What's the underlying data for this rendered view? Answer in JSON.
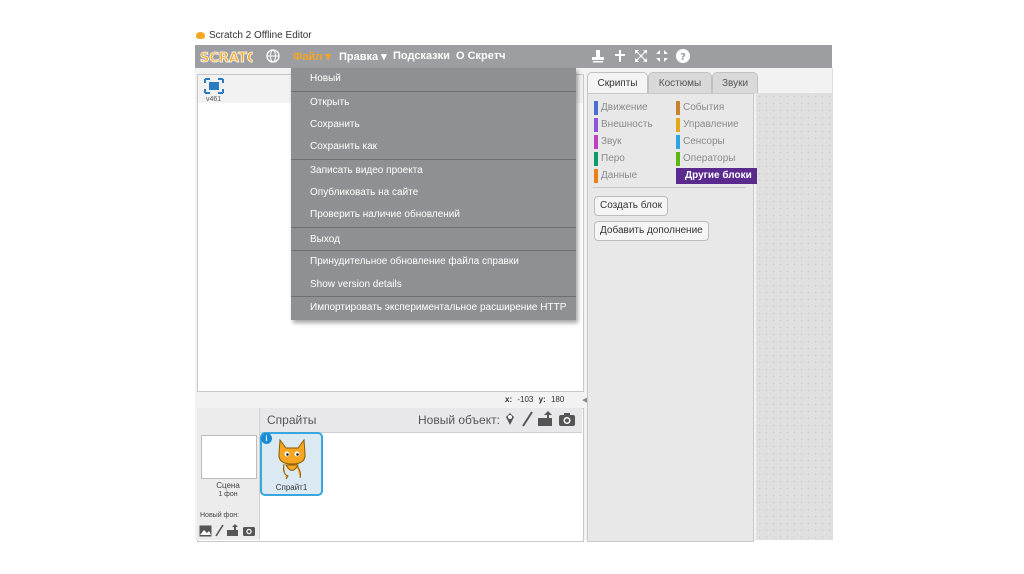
{
  "window": {
    "title": "Scratch 2 Offline Editor"
  },
  "logo": {
    "text": "SCRATCH"
  },
  "menubar": {
    "file": "Файл ▾",
    "edit": "Правка ▾",
    "tips": "Подсказки",
    "about": "О Скретч",
    "icons": [
      "globe-icon",
      "duplicate-stamp-icon",
      "delete-cut-icon",
      "grow-icon",
      "shrink-icon",
      "help-icon"
    ]
  },
  "file_menu": {
    "items": [
      "Новый",
      "Открыть",
      "Сохранить",
      "Сохранить как",
      "Записать видео проекта",
      "Опубликовать на сайте",
      "Проверить наличие обновлений",
      "Выход",
      "Принудительное обновление файла справки",
      "Show version details",
      "Импортировать экспериментальное расширение HTTP"
    ]
  },
  "stage": {
    "version": "v461",
    "coords": {
      "x_label": "x:",
      "x": "-103",
      "y_label": "y:",
      "y": "180"
    }
  },
  "sprites": {
    "label": "Спрайты",
    "new_object": "Новый объект:",
    "stage_name": "Сцена",
    "stage_backdrops": "1 фон",
    "new_backdrop": "Новый фон:",
    "sprite_name": "Спрайт1"
  },
  "tabs": {
    "scripts": "Скрипты",
    "costumes": "Костюмы",
    "sounds": "Звуки"
  },
  "categories": [
    {
      "label": "Движение",
      "color": "#4a6cd4"
    },
    {
      "label": "Внешность",
      "color": "#8a55d7"
    },
    {
      "label": "Звук",
      "color": "#bb42c3"
    },
    {
      "label": "Перо",
      "color": "#0e9a6c"
    },
    {
      "label": "Данные",
      "color": "#ee7d16"
    },
    {
      "label": "События",
      "color": "#c88330"
    },
    {
      "label": "Управление",
      "color": "#e1a91a"
    },
    {
      "label": "Сенсоры",
      "color": "#2ca5e2"
    },
    {
      "label": "Операторы",
      "color": "#5cb712"
    },
    {
      "label": "Другие блоки",
      "color": "#632d99"
    }
  ],
  "palette": {
    "make_block": "Создать блок",
    "add_extension": "Добавить дополнение"
  },
  "colors": {
    "menubar": "#9c9ea2",
    "menu": "#8f9093",
    "accent": "#f6a623",
    "selection": "#3aa6de"
  }
}
